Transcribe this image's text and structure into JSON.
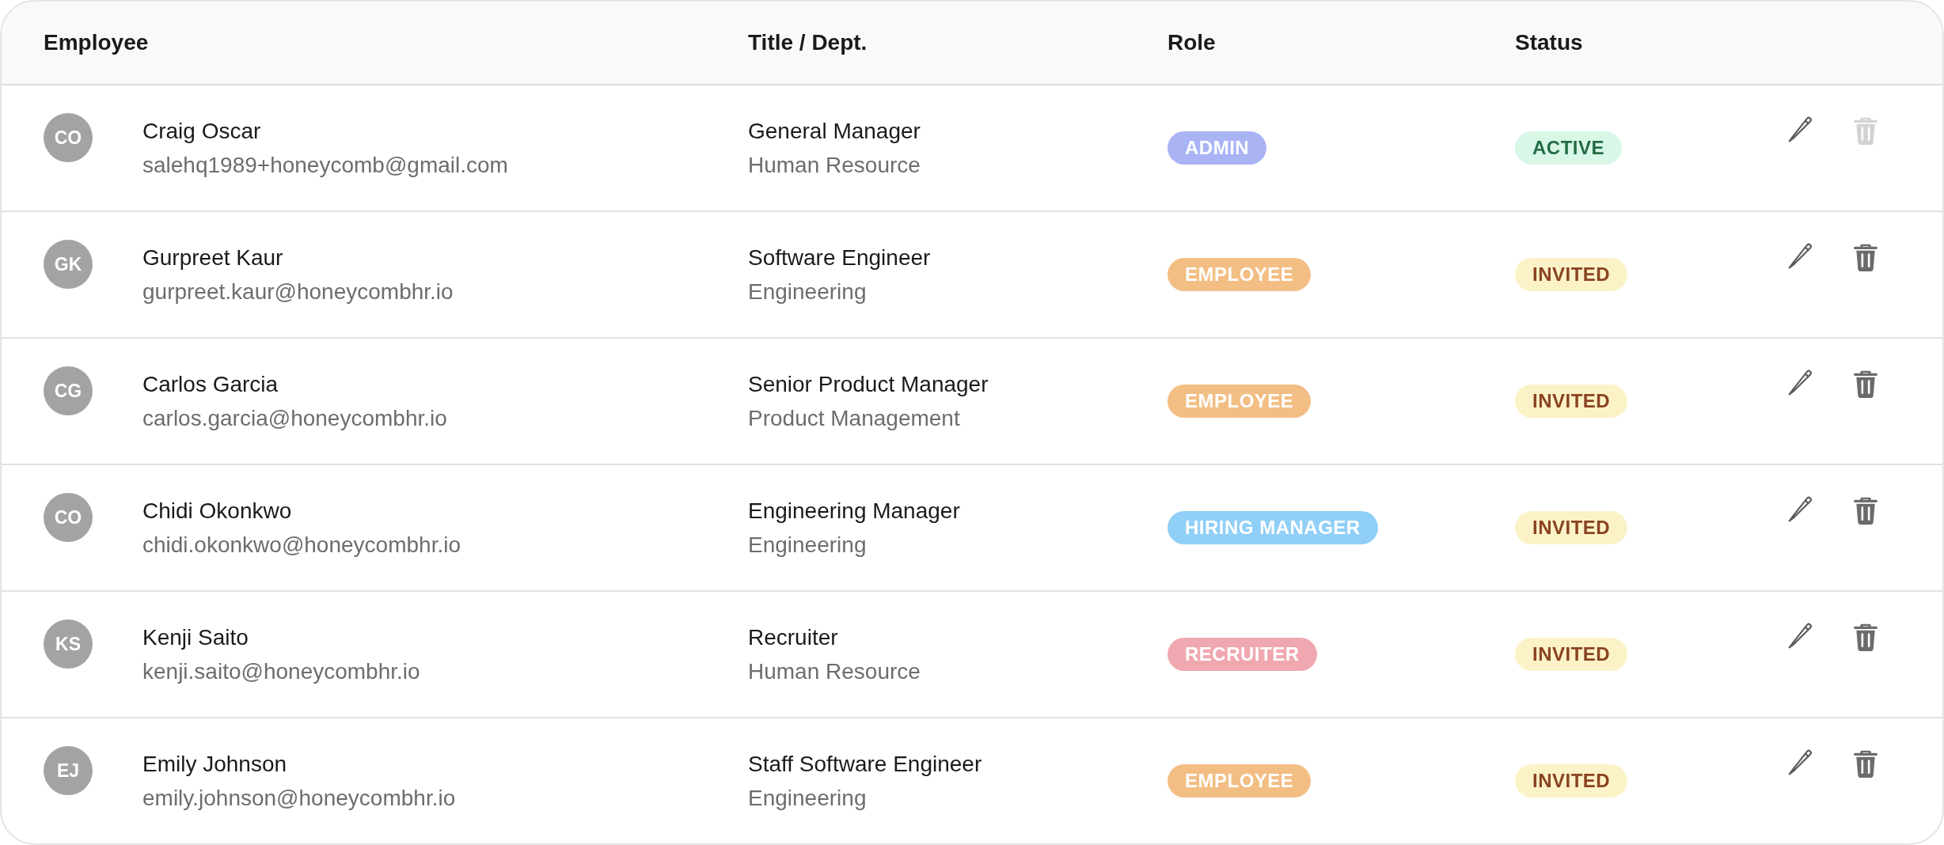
{
  "table": {
    "columns": [
      "Employee",
      "Title / Dept.",
      "Role",
      "Status"
    ],
    "rows": [
      {
        "initials": "CO",
        "name": "Craig Oscar",
        "email": "salehq1989+honeycomb@gmail.com",
        "title": "General Manager",
        "dept": "Human Resource",
        "role": {
          "label": "ADMIN",
          "color": "#aab4f5"
        },
        "status": {
          "label": "ACTIVE",
          "kind": "active"
        },
        "delete_disabled": true
      },
      {
        "initials": "GK",
        "name": "Gurpreet Kaur",
        "email": "gurpreet.kaur@honeycombhr.io",
        "title": "Software Engineer",
        "dept": "Engineering",
        "role": {
          "label": "EMPLOYEE",
          "color": "#f3be84"
        },
        "status": {
          "label": "INVITED",
          "kind": "invited"
        },
        "delete_disabled": false
      },
      {
        "initials": "CG",
        "name": "Carlos Garcia",
        "email": "carlos.garcia@honeycombhr.io",
        "title": "Senior Product Manager",
        "dept": "Product Management",
        "role": {
          "label": "EMPLOYEE",
          "color": "#f3be84"
        },
        "status": {
          "label": "INVITED",
          "kind": "invited"
        },
        "delete_disabled": false
      },
      {
        "initials": "CO",
        "name": "Chidi Okonkwo",
        "email": "chidi.okonkwo@honeycombhr.io",
        "title": "Engineering Manager",
        "dept": "Engineering",
        "role": {
          "label": "HIRING MANAGER",
          "color": "#90cff7"
        },
        "status": {
          "label": "INVITED",
          "kind": "invited"
        },
        "delete_disabled": false
      },
      {
        "initials": "KS",
        "name": "Kenji Saito",
        "email": "kenji.saito@honeycombhr.io",
        "title": "Recruiter",
        "dept": "Human Resource",
        "role": {
          "label": "RECRUITER",
          "color": "#f0a8b0"
        },
        "status": {
          "label": "INVITED",
          "kind": "invited"
        },
        "delete_disabled": false
      },
      {
        "initials": "EJ",
        "name": "Emily Johnson",
        "email": "emily.johnson@honeycombhr.io",
        "title": "Staff Software Engineer",
        "dept": "Engineering",
        "role": {
          "label": "EMPLOYEE",
          "color": "#f3be84"
        },
        "status": {
          "label": "INVITED",
          "kind": "invited"
        },
        "delete_disabled": false
      }
    ]
  }
}
